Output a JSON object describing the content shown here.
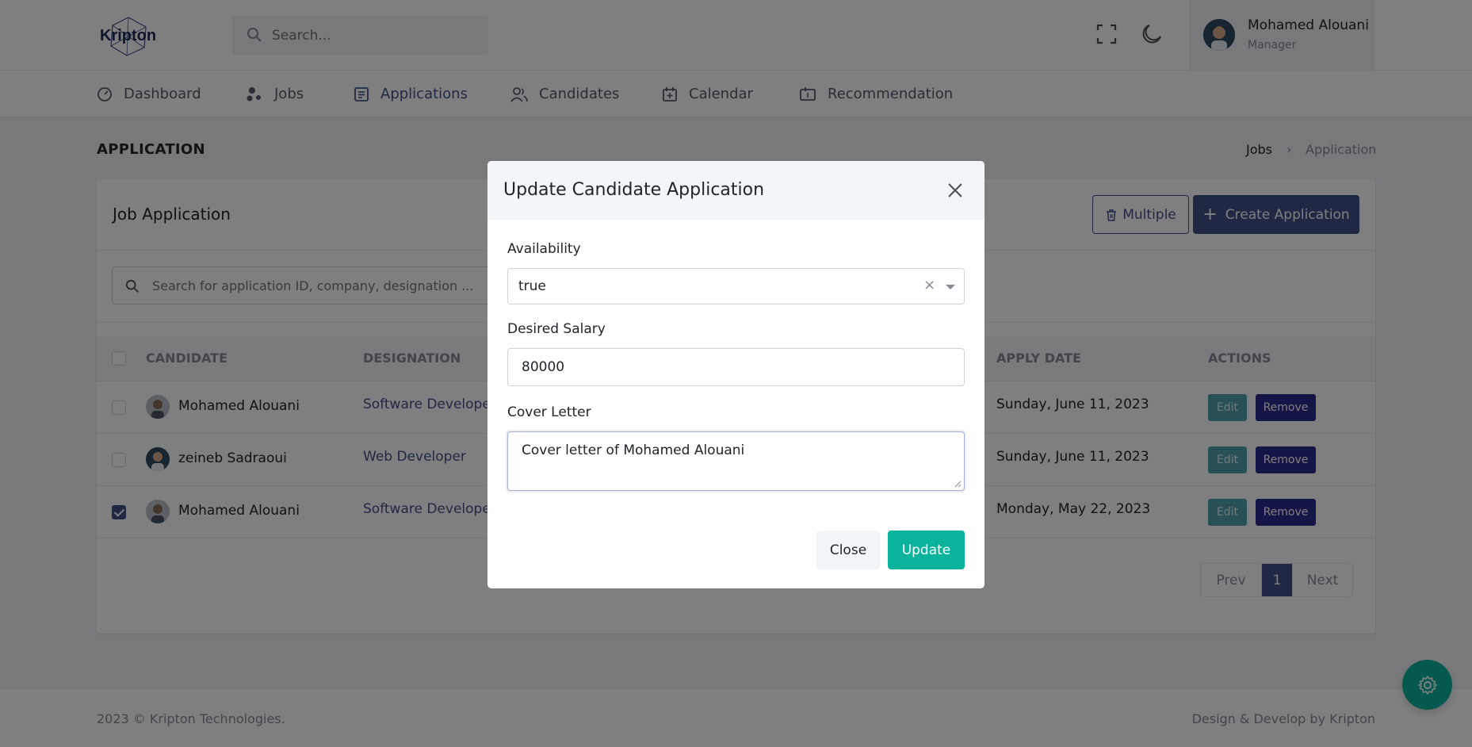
{
  "app": {
    "logo_text": "Kripton",
    "search_placeholder": "Search...",
    "user": {
      "name": "Mohamed Alouani",
      "role": "Manager"
    }
  },
  "nav": {
    "items": [
      {
        "label": "Dashboard",
        "icon": "dashboard-icon"
      },
      {
        "label": "Jobs",
        "icon": "jobs-icon"
      },
      {
        "label": "Applications",
        "icon": "applications-icon",
        "active": true
      },
      {
        "label": "Candidates",
        "icon": "candidates-icon"
      },
      {
        "label": "Calendar",
        "icon": "calendar-icon"
      },
      {
        "label": "Recommendation",
        "icon": "recommendation-icon"
      }
    ]
  },
  "page": {
    "title": "APPLICATION",
    "breadcrumb": [
      "Jobs",
      "Application"
    ]
  },
  "card": {
    "title": "Job Application",
    "multiple_label": "Multiple",
    "create_label": "Create Application",
    "search_placeholder": "Search for application ID, company, designation ..."
  },
  "table": {
    "headers": [
      "CANDIDATE",
      "DESIGNATION",
      "APPLY DATE",
      "ACTIONS"
    ],
    "rows": [
      {
        "name": "Mohamed Alouani",
        "designation": "Software Developer",
        "date": "Sunday, June 11, 2023",
        "checked": false
      },
      {
        "name": "zeineb Sadraoui",
        "designation": "Web Developer",
        "date": "Sunday, June 11, 2023",
        "checked": false
      },
      {
        "name": "Mohamed Alouani",
        "designation": "Software Developer",
        "date": "Monday, May 22, 2023",
        "checked": true
      }
    ],
    "edit_label": "Edit",
    "remove_label": "Remove"
  },
  "pagination": {
    "prev": "Prev",
    "current": "1",
    "next": "Next"
  },
  "footer": {
    "left": "2023 © Kripton Technologies.",
    "right": "Design & Develop by Kripton"
  },
  "modal": {
    "title": "Update Candidate Application",
    "availability_label": "Availability",
    "availability_value": "true",
    "salary_label": "Desired Salary",
    "salary_value": "80000",
    "cover_label": "Cover Letter",
    "cover_value": "Cover letter of Mohamed Alouani",
    "close_label": "Close",
    "update_label": "Update"
  },
  "colors": {
    "primary": "#405189",
    "success": "#0ab39c",
    "info": "#3b9aa6"
  }
}
